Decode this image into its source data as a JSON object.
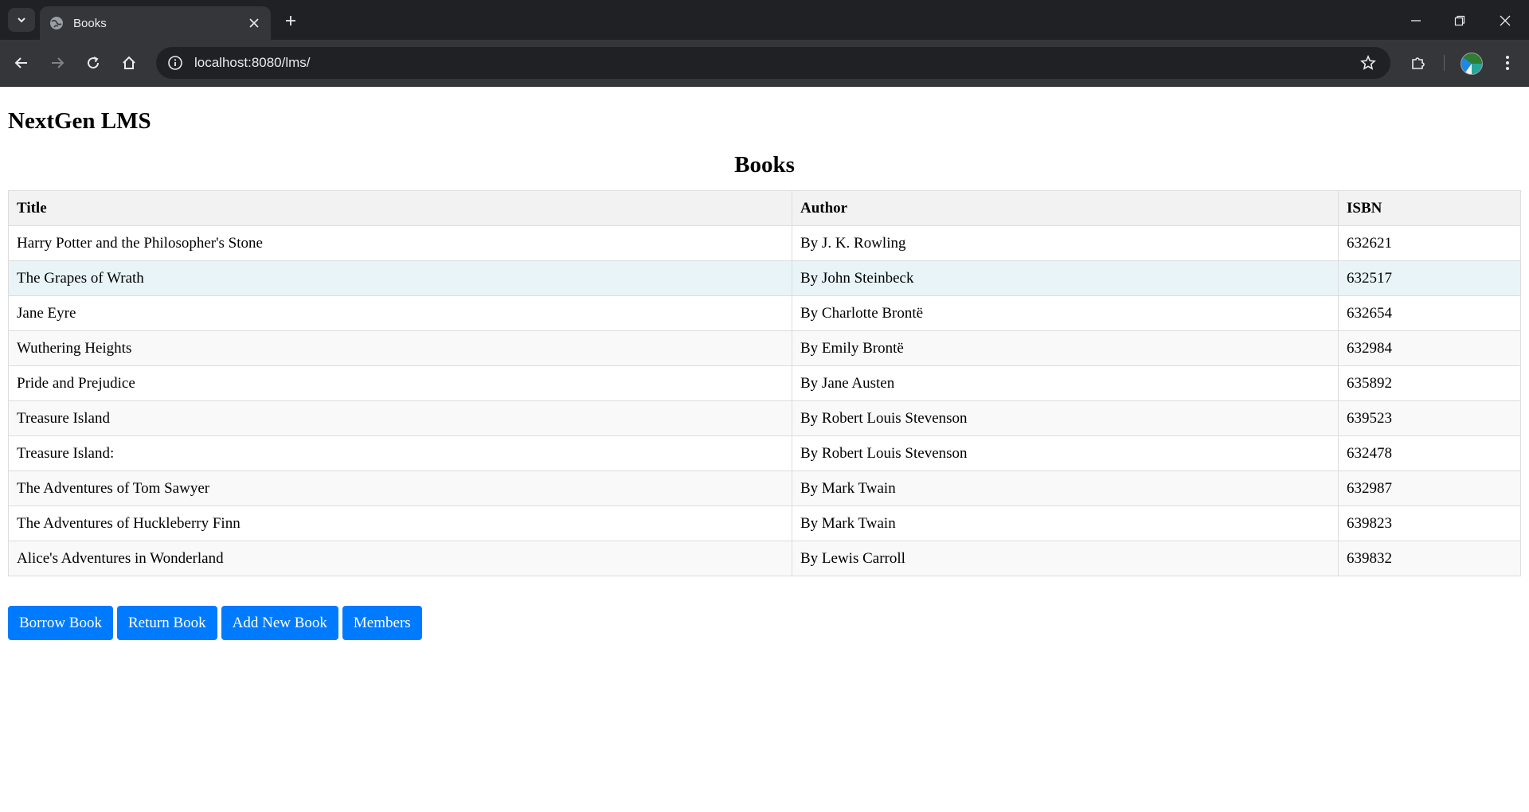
{
  "browser": {
    "tab_title": "Books",
    "url": "localhost:8080/lms/",
    "icons": {
      "tab_search": "chevron-down-icon",
      "favicon": "globe-icon",
      "tab_close": "close-icon",
      "new_tab": "plus-icon",
      "back": "arrow-left-icon",
      "forward": "arrow-right-icon",
      "reload": "reload-icon",
      "home": "home-icon",
      "site_info": "info-icon",
      "bookmark": "star-icon",
      "extensions": "puzzle-icon",
      "menu": "kebab-menu-icon",
      "minimize": "minimize-icon",
      "restore": "restore-icon",
      "close_window": "close-icon"
    }
  },
  "page": {
    "site_title": "NextGen LMS",
    "heading": "Books",
    "table": {
      "headers": [
        "Title",
        "Author",
        "ISBN"
      ],
      "rows": [
        {
          "title": "Harry Potter and the Philosopher's Stone",
          "author": "By J. K. Rowling",
          "isbn": "632621"
        },
        {
          "title": "The Grapes of Wrath",
          "author": "By John Steinbeck",
          "isbn": "632517"
        },
        {
          "title": "Jane Eyre",
          "author": "By Charlotte Brontë",
          "isbn": "632654"
        },
        {
          "title": "Wuthering Heights",
          "author": "By Emily Brontë",
          "isbn": "632984"
        },
        {
          "title": "Pride and Prejudice",
          "author": "By Jane Austen",
          "isbn": "635892"
        },
        {
          "title": "Treasure Island",
          "author": "By Robert Louis Stevenson",
          "isbn": "639523"
        },
        {
          "title": "Treasure Island:",
          "author": "By Robert Louis Stevenson",
          "isbn": "632478"
        },
        {
          "title": "The Adventures of Tom Sawyer",
          "author": "By Mark Twain",
          "isbn": "632987"
        },
        {
          "title": "The Adventures of Huckleberry Finn",
          "author": "By Mark Twain",
          "isbn": "639823"
        },
        {
          "title": "Alice's Adventures in Wonderland",
          "author": "By Lewis Carroll",
          "isbn": "639832"
        }
      ]
    },
    "buttons": {
      "borrow": "Borrow Book",
      "return": "Return Book",
      "add": "Add New Book",
      "members": "Members"
    }
  },
  "colors": {
    "button_bg": "#007bff",
    "header_bg": "#f2f2f2",
    "row_hover_bg": "#e8f4f8",
    "chrome_dark": "#202124",
    "chrome_toolbar": "#35363a"
  }
}
